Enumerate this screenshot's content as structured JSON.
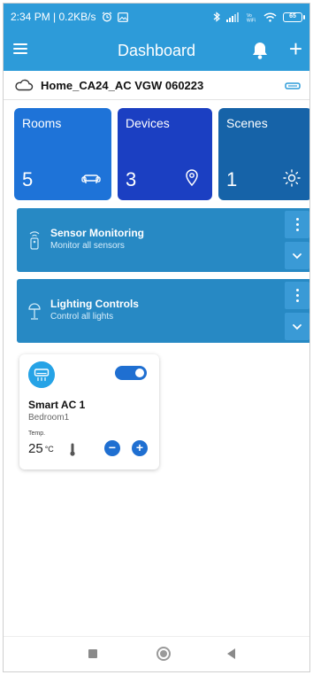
{
  "statusbar": {
    "time_network": "2:34 PM | 0.2KB/s",
    "battery": "65"
  },
  "appbar": {
    "title": "Dashboard"
  },
  "home": {
    "name": "Home_CA24_AC VGW 060223"
  },
  "tiles": [
    {
      "label": "Rooms",
      "value": "5",
      "icon": "sofa-icon",
      "color": "#1e73d8"
    },
    {
      "label": "Devices",
      "value": "3",
      "icon": "location-pin-icon",
      "color": "#1b3fc2"
    },
    {
      "label": "Scenes",
      "value": "1",
      "icon": "sun-icon",
      "color": "#1663a8"
    }
  ],
  "panels": [
    {
      "title": "Sensor Monitoring",
      "subtitle": "Monitor all sensors",
      "icon": "sensor-icon"
    },
    {
      "title": "Lighting Controls",
      "subtitle": "Control all lights",
      "icon": "lamp-icon"
    }
  ],
  "device": {
    "name": "Smart AC 1",
    "room": "Bedroom1",
    "temp_label": "Temp.",
    "temp_value": "25",
    "temp_unit": "°C",
    "power_on": true,
    "minus_label": "−",
    "plus_label": "+"
  },
  "colors": {
    "primary": "#2d9bd9",
    "panel": "#2789c4",
    "accent": "#1f6fd1"
  }
}
